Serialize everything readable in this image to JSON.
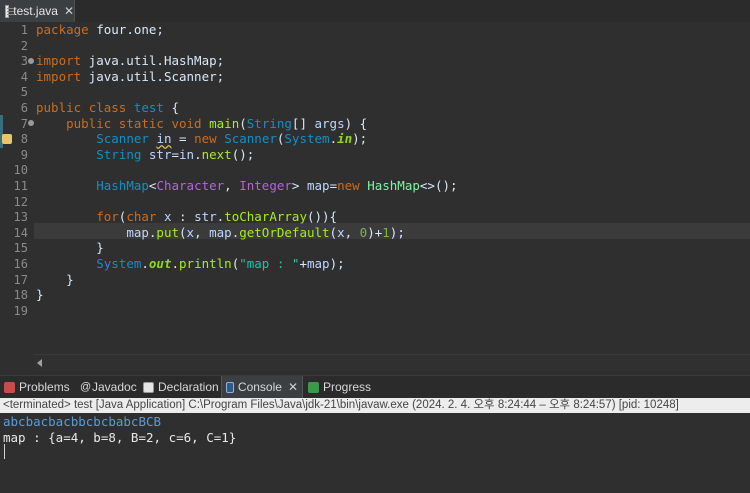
{
  "editor_tab": {
    "file": "test.java",
    "close": "✕"
  },
  "line_numbers": [
    "1",
    "2",
    "3",
    "4",
    "5",
    "6",
    "7",
    "8",
    "9",
    "10",
    "11",
    "12",
    "13",
    "14",
    "15",
    "16",
    "17",
    "18",
    "19"
  ],
  "code": {
    "l1": [
      "package",
      " four.one;"
    ],
    "l3": [
      "import",
      " java.util.HashMap;"
    ],
    "l4": [
      "import",
      " java.util.Scanner;"
    ],
    "l6": [
      "public",
      " ",
      "class",
      " ",
      "test",
      " {"
    ],
    "l7": [
      "    ",
      "public",
      " ",
      "static",
      " ",
      "void",
      " ",
      "main",
      "(",
      "String",
      "[] ",
      "args",
      ") {"
    ],
    "l8": [
      "        ",
      "Scanner",
      " ",
      "in",
      " = ",
      "new",
      " ",
      "Scanner",
      "(",
      "System",
      ".",
      "in",
      ");"
    ],
    "l9": [
      "        ",
      "String",
      " ",
      "str",
      "=",
      "in",
      ".",
      "next",
      "();"
    ],
    "l11": [
      "        ",
      "HashMap",
      "<",
      "Character",
      ", ",
      "Integer",
      "> ",
      "map",
      "=",
      "new",
      " ",
      "HashMap",
      "<>();"
    ],
    "l13": [
      "        ",
      "for",
      "(",
      "char",
      " ",
      "x",
      " : ",
      "str",
      ".",
      "toCharArray",
      "()){"
    ],
    "l14": [
      "            ",
      "map",
      ".",
      "put",
      "(",
      "x",
      ", ",
      "map",
      ".",
      "getOrDefault",
      "(",
      "x",
      ", ",
      "0",
      ")+",
      "1",
      ");"
    ],
    "l15": [
      "        }"
    ],
    "l16": [
      "        ",
      "System",
      ".",
      "out",
      ".",
      "println",
      "(",
      "\"map : \"",
      "+",
      "map",
      ");"
    ],
    "l17": [
      "    }"
    ],
    "l18": [
      "}"
    ]
  },
  "panel_tabs": [
    {
      "label": "Problems"
    },
    {
      "label": "Javadoc"
    },
    {
      "label": "Declaration"
    },
    {
      "label": "Console",
      "close": "✕"
    },
    {
      "label": "Progress"
    }
  ],
  "console": {
    "status": "<terminated> test [Java Application] C:\\Program Files\\Java\\jdk-21\\bin\\javaw.exe  (2024. 2. 4. 오후 8:24:44 – 오후 8:24:57) [pid: 10248]",
    "input_line": "abcbacbacbbcbcbabcBCB",
    "output_line": "map : {a=4, b=8, B=2, c=6, C=1}"
  },
  "colors": {
    "input_text": "#5b9bd5",
    "output_text": "#e8e8e8"
  }
}
